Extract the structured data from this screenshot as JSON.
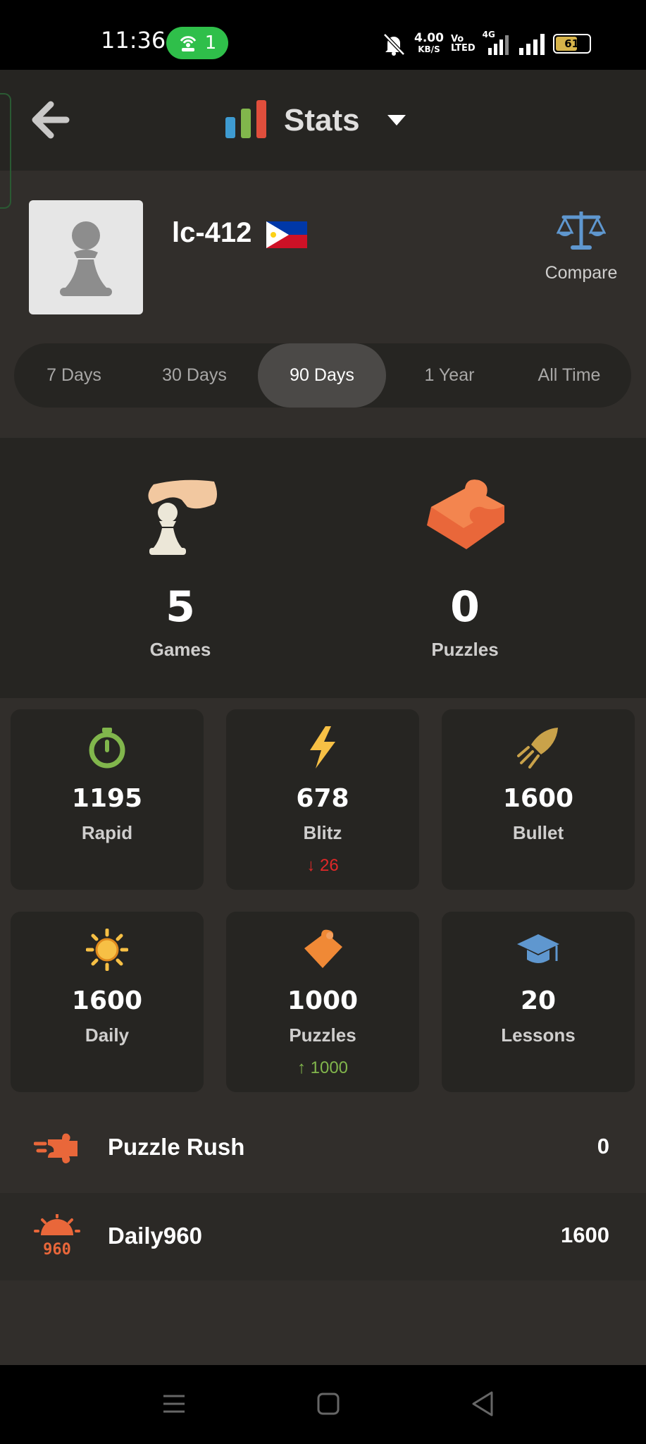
{
  "status_bar": {
    "time": "11:36",
    "hotspot_count": "1",
    "net_speed": "4.00",
    "net_speed_unit": "KB/S",
    "volte_top": "Vo",
    "volte_bottom": "LTED",
    "network": "4G",
    "battery": "61"
  },
  "header": {
    "title": "Stats"
  },
  "profile": {
    "username": "lc-412",
    "compare_label": "Compare"
  },
  "time_range": {
    "options": [
      "7 Days",
      "30 Days",
      "90 Days",
      "1 Year",
      "All Time"
    ],
    "selected": "90 Days"
  },
  "summary": {
    "games_count": "5",
    "games_label": "Games",
    "puzzles_count": "0",
    "puzzles_label": "Puzzles"
  },
  "ratings": [
    {
      "value": "1195",
      "label": "Rapid",
      "icon": "stopwatch-icon",
      "color": "#81b64c"
    },
    {
      "value": "678",
      "label": "Blitz",
      "icon": "lightning-icon",
      "color": "#f7c045",
      "delta": "26",
      "delta_direction": "down",
      "delta_color": "#e02828"
    },
    {
      "value": "1600",
      "label": "Bullet",
      "icon": "bullet-icon",
      "color": "#c9a24a"
    },
    {
      "value": "1600",
      "label": "Daily",
      "icon": "sun-icon",
      "color": "#f7c045"
    },
    {
      "value": "1000",
      "label": "Puzzles",
      "icon": "puzzle-icon",
      "color": "#f08936",
      "delta": "1000",
      "delta_direction": "up",
      "delta_color": "#81b64c"
    },
    {
      "value": "20",
      "label": "Lessons",
      "icon": "graduation-cap-icon",
      "color": "#5f97cf"
    }
  ],
  "rows": [
    {
      "name": "Puzzle Rush",
      "score": "0",
      "icon": "puzzle-rush-icon"
    },
    {
      "name": "Daily960",
      "score": "1600",
      "icon": "daily960-icon",
      "icon_text": "960"
    }
  ]
}
